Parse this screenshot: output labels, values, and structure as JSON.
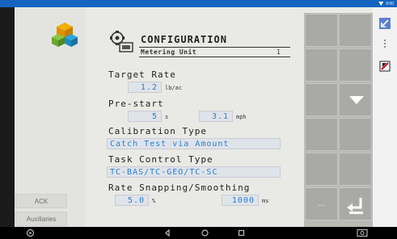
{
  "status_bar": {
    "time": "9:00"
  },
  "left_panel": {
    "ack_label": "ACK",
    "auxiliaries_label": "Auxiliaries"
  },
  "header": {
    "title": "CONFIGURATION",
    "subtitle": "Metering Unit",
    "unit_number": "1"
  },
  "form": {
    "target_rate": {
      "label": "Target Rate",
      "value": "1.2",
      "unit": "lb/ac"
    },
    "pre_start": {
      "label": "Pre-start",
      "time_value": "5",
      "time_unit": "s",
      "speed_value": "3.1",
      "speed_unit": "mph"
    },
    "calibration_type": {
      "label": "Calibration Type",
      "value": "Catch Test via Amount"
    },
    "task_control_type": {
      "label": "Task Control Type",
      "value": "TC-BAS/TC-GEO/TC-SC"
    },
    "rate_snapping": {
      "label": "Rate Snapping/Smoothing",
      "percent_value": "5.0",
      "percent_unit": "%",
      "ms_value": "1000",
      "ms_unit": "ms"
    }
  },
  "softkeys": {
    "more_label": "...",
    "down_icon": "down-arrow-icon",
    "back_icon": "return-icon"
  },
  "right_bar": {
    "icons": [
      "minimize-icon",
      "menu-icon",
      "alarm-icon"
    ]
  },
  "nav_bar": {
    "icons": [
      "home-icon",
      "back-icon",
      "circle-home-icon",
      "recents-icon",
      "screenshot-icon"
    ]
  },
  "colors": {
    "status_bar": "#1565c0",
    "field_text": "#2a7fd4",
    "field_bg": "#dfe3ea",
    "softkey": "#a9aaa5"
  }
}
